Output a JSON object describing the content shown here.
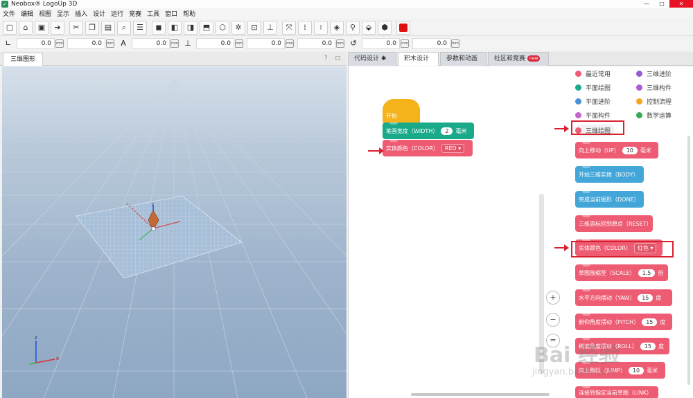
{
  "window": {
    "title": "Neobox® LogoUp 3D",
    "controls": [
      "—",
      "□",
      "✕"
    ]
  },
  "menu": [
    "文件",
    "编辑",
    "视图",
    "显示",
    "插入",
    "设计",
    "运行",
    "竞赛",
    "工具",
    "窗口",
    "帮助"
  ],
  "toolbar2": {
    "values": [
      "0.0",
      "0.0",
      "0.0",
      "0.0",
      "0.0",
      "0.0",
      "0.0",
      "0.0"
    ],
    "unit": "mm"
  },
  "left_panel": {
    "tab": "三维图形",
    "ctrls": [
      "?",
      "□"
    ]
  },
  "right_tabs": [
    {
      "label": "代码设计 ✱"
    },
    {
      "label": "积木设计"
    },
    {
      "label": "参数和动画"
    },
    {
      "label": "社区和竞赛",
      "badge": "new"
    }
  ],
  "workspace": {
    "start": "开始",
    "pen_width": {
      "label": "笔画宽度（WIDTH）",
      "value": "2",
      "unit": "毫米"
    },
    "color": {
      "label": "实体颜色（COLOR）",
      "value": "RED ▾"
    }
  },
  "categories": [
    {
      "label": "最近常用",
      "color": "#ee5c73"
    },
    {
      "label": "三维进阶",
      "color": "#9b59d0"
    },
    {
      "label": "平面绘图",
      "color": "#1aaa8a"
    },
    {
      "label": "三维构件",
      "color": "#b05ad6"
    },
    {
      "label": "平面进阶",
      "color": "#4a90d9"
    },
    {
      "label": "控制流程",
      "color": "#f6a623"
    },
    {
      "label": "平面构件",
      "color": "#c765c9"
    },
    {
      "label": "数学运算",
      "color": "#3aa95a"
    },
    {
      "label": "三维绘图",
      "color": "#ee5c73"
    }
  ],
  "palette_blocks": [
    {
      "label": "向上移动（UP）",
      "value": "10",
      "unit": "毫米",
      "kind": "pink"
    },
    {
      "label": "开始三维实体（BODY）",
      "kind": "blue"
    },
    {
      "label": "完成当前图形（DONE）",
      "kind": "blue"
    },
    {
      "label": "三维游标回到原点（RESET）",
      "kind": "pink"
    },
    {
      "label": "实体颜色（COLOR）",
      "dropdown": "红色 ▾",
      "kind": "pink"
    },
    {
      "label": "草图放缩至（SCALE）",
      "value": "1.5",
      "unit": "倍",
      "kind": "pink"
    },
    {
      "label": "水平方向摆动（YAW）",
      "value": "15",
      "unit": "度",
      "kind": "pink"
    },
    {
      "label": "俯仰角度摆动（PITCH）",
      "value": "15",
      "unit": "度",
      "kind": "pink"
    },
    {
      "label": "横滚角度摆动（ROLL）",
      "value": "15",
      "unit": "度",
      "kind": "pink"
    },
    {
      "label": "向上跳跃（JUMP）",
      "value": "10",
      "unit": "毫米",
      "kind": "pink"
    },
    {
      "label": "连接到指定当前草图（LINK）",
      "kind": "pink"
    }
  ],
  "zoom": {
    "in": "+",
    "out": "−",
    "reset": "="
  },
  "watermark": {
    "logo": "Bai 经验",
    "url": "jingyan.baidu.com"
  }
}
